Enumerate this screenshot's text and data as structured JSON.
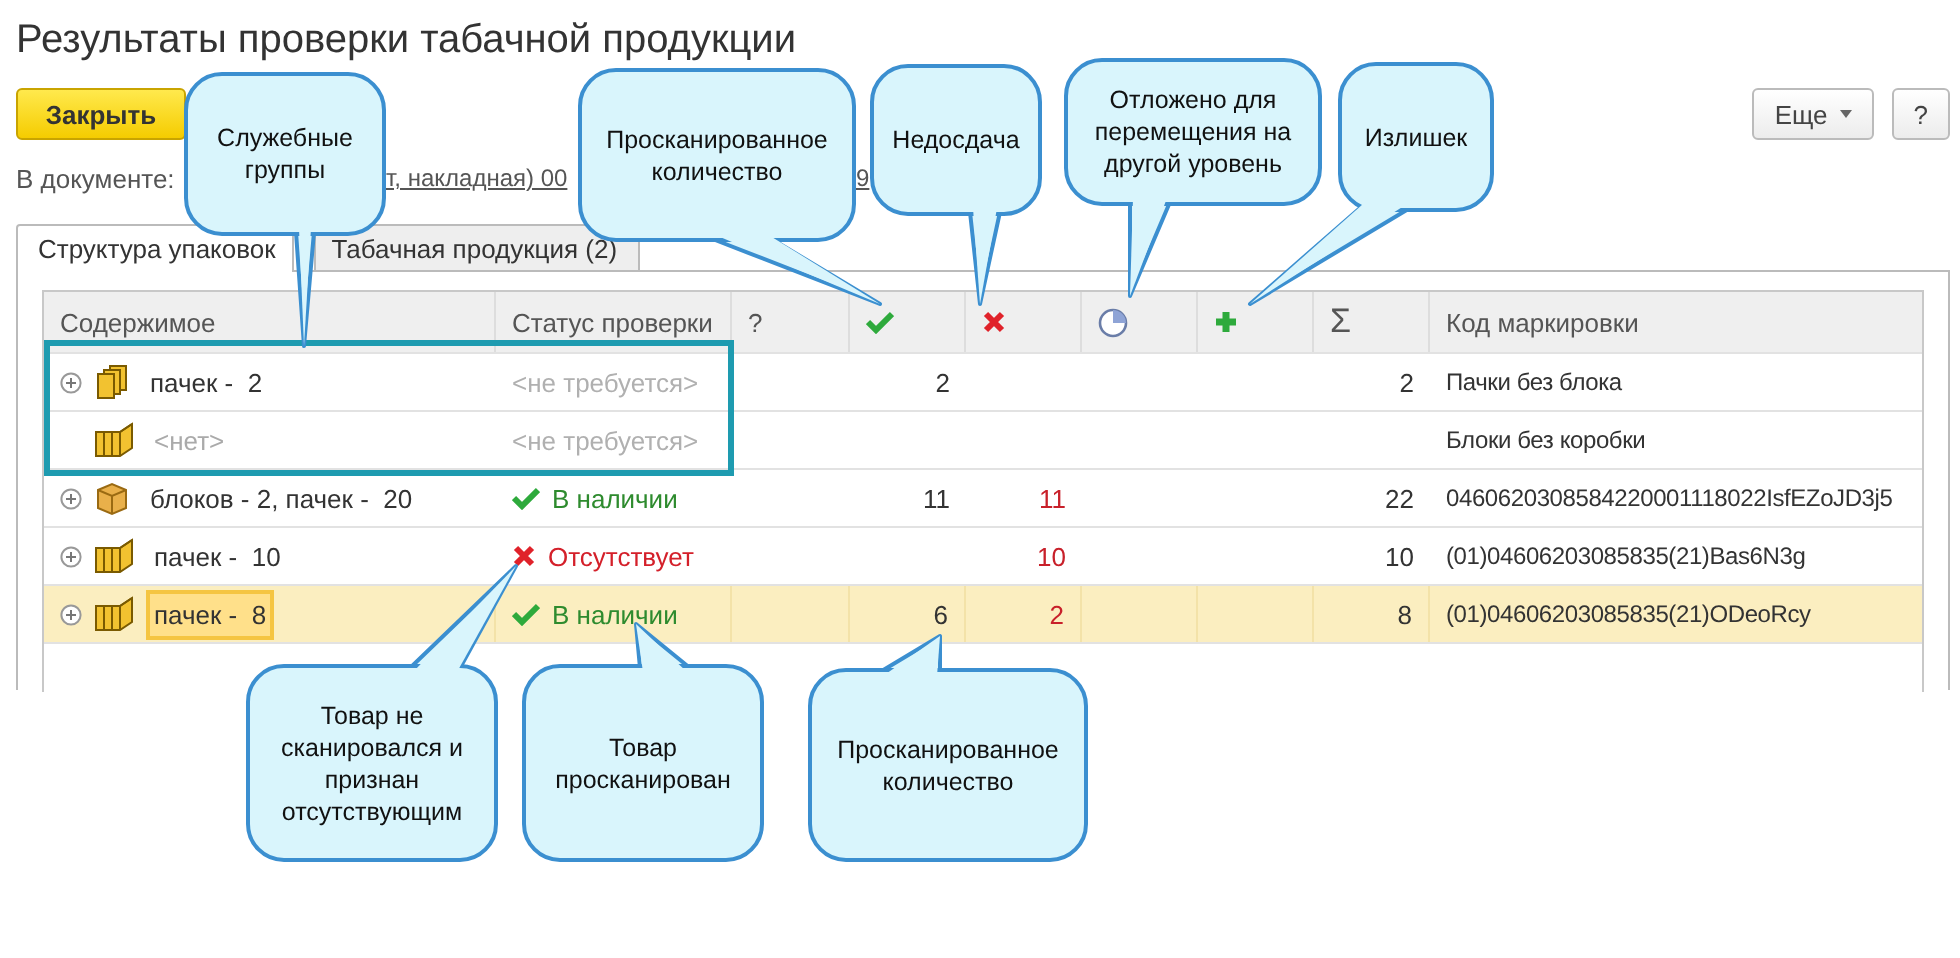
{
  "window": {
    "title": "Результаты проверки табачной продукции"
  },
  "toolbar": {
    "close_button": "Закрыть",
    "more_button": "Еще",
    "help_button": "?"
  },
  "document": {
    "label": "В документе:",
    "link_fragments": [
      "т, накладная) 00",
      "9"
    ]
  },
  "tabs": [
    {
      "label": "Структура упаковок",
      "selected": true
    },
    {
      "label": "Табачная продукция (2)",
      "selected": false
    }
  ],
  "table": {
    "columns": [
      {
        "kind": "text",
        "label": "Содержимое"
      },
      {
        "kind": "text",
        "label": "Статус проверки"
      },
      {
        "kind": "text",
        "label": "?"
      },
      {
        "kind": "ok"
      },
      {
        "kind": "shortage"
      },
      {
        "kind": "postponed"
      },
      {
        "kind": "surplus"
      },
      {
        "kind": "text",
        "label": "Σ"
      },
      {
        "kind": "text",
        "label": "Код маркировки"
      }
    ],
    "rows": [
      {
        "expandable": true,
        "package": {
          "kind": "packs"
        },
        "content": "пачек -  2",
        "content_muted": false,
        "status": {
          "kind": "none",
          "label": "<не требуется>"
        },
        "scanned": "2",
        "shortage": "",
        "total": "2",
        "code": "Пачки без блока",
        "selected": false
      },
      {
        "expandable": false,
        "package": {
          "kind": "block"
        },
        "content": "<нет>",
        "content_muted": true,
        "status": {
          "kind": "none",
          "label": "<не требуется>"
        },
        "scanned": "",
        "shortage": "",
        "total": "",
        "code": "Блоки без коробки",
        "selected": false
      },
      {
        "expandable": true,
        "package": {
          "kind": "box"
        },
        "content": "блоков - 2, пачек -  20",
        "content_muted": false,
        "status": {
          "kind": "ok",
          "label": "В наличии"
        },
        "scanned": "11",
        "shortage": "11",
        "total": "22",
        "code": "0460620308584220001118022IsfEZoJD3j5",
        "selected": false
      },
      {
        "expandable": true,
        "package": {
          "kind": "block"
        },
        "content": "пачек -  10",
        "content_muted": false,
        "status": {
          "kind": "missing",
          "label": "Отсутствует"
        },
        "scanned": "",
        "shortage": "10",
        "total": "10",
        "code": "(01)04606203085835(21)Bas6N3g",
        "selected": false
      },
      {
        "expandable": true,
        "package": {
          "kind": "block"
        },
        "content": "пачек -  8",
        "content_muted": false,
        "status": {
          "kind": "ok",
          "label": "В наличии"
        },
        "scanned": "6",
        "shortage": "2",
        "total": "8",
        "code": "(01)04606203085835(21)ODeoRcy",
        "selected": true
      }
    ]
  },
  "callouts": [
    {
      "text": "Служебные группы"
    },
    {
      "text": "Просканированное количество"
    },
    {
      "text": "Недосдача"
    },
    {
      "text": "Отложено для перемещения на другой уровень"
    },
    {
      "text": "Излишек"
    },
    {
      "text": "Товар не сканировался и признан отсутствующим"
    },
    {
      "text": "Товар просканирован"
    },
    {
      "text": "Просканированное количество"
    }
  ]
}
